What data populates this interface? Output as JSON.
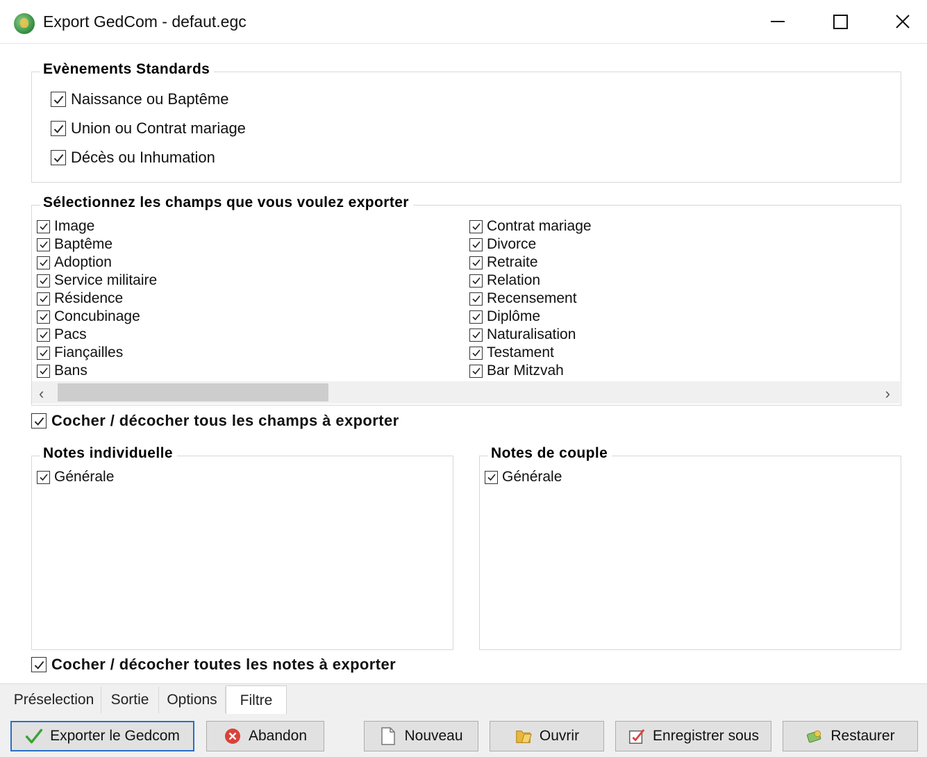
{
  "window": {
    "title": "Export GedCom - defaut.egc",
    "icon": "app-tree-icon",
    "controls": [
      "minimize-icon",
      "maximize-icon",
      "close-icon"
    ]
  },
  "standard_events": {
    "title": "Evènements Standards",
    "items": [
      {
        "label": "Naissance ou Baptême",
        "checked": true
      },
      {
        "label": "Union ou Contrat mariage",
        "checked": true
      },
      {
        "label": "Décès ou Inhumation",
        "checked": true
      }
    ]
  },
  "fields": {
    "title": "Sélectionnez les champs que vous voulez exporter",
    "col1": [
      {
        "label": "Image",
        "checked": true
      },
      {
        "label": "Baptême",
        "checked": true
      },
      {
        "label": "Adoption",
        "checked": true
      },
      {
        "label": "Service militaire",
        "checked": true
      },
      {
        "label": "Résidence",
        "checked": true
      },
      {
        "label": "Concubinage",
        "checked": true
      },
      {
        "label": "Pacs",
        "checked": true
      },
      {
        "label": "Fiançailles",
        "checked": true
      },
      {
        "label": "Bans",
        "checked": true
      }
    ],
    "col2": [
      {
        "label": "Contrat mariage",
        "checked": true
      },
      {
        "label": "Divorce",
        "checked": true
      },
      {
        "label": "Retraite",
        "checked": true
      },
      {
        "label": "Relation",
        "checked": true
      },
      {
        "label": "Recensement",
        "checked": true
      },
      {
        "label": "Diplôme",
        "checked": true
      },
      {
        "label": "Naturalisation",
        "checked": true
      },
      {
        "label": "Testament",
        "checked": true
      },
      {
        "label": "Bar Mitzvah",
        "checked": true
      }
    ]
  },
  "toggle_fields": {
    "label": "Cocher / décocher tous les champs à exporter",
    "checked": true
  },
  "notes_individual": {
    "title": "Notes individuelle",
    "items": [
      {
        "label": "Générale",
        "checked": true
      }
    ]
  },
  "notes_couple": {
    "title": "Notes de couple",
    "items": [
      {
        "label": "Générale",
        "checked": true
      }
    ]
  },
  "toggle_notes": {
    "label": "Cocher / décocher toutes les notes à exporter",
    "checked": true
  },
  "tabs": [
    {
      "label": "Préselection"
    },
    {
      "label": "Sortie"
    },
    {
      "label": "Options"
    },
    {
      "label": "Filtre",
      "active": true
    }
  ],
  "buttons": {
    "export": {
      "label": "Exporter le Gedcom",
      "icon": "checkmark-icon"
    },
    "abort": {
      "label": "Abandon",
      "icon": "cancel-icon"
    },
    "new": {
      "label": "Nouveau",
      "icon": "new-document-icon"
    },
    "open": {
      "label": "Ouvrir",
      "icon": "open-folder-icon"
    },
    "save_as": {
      "label": "Enregistrer sous",
      "icon": "save-as-icon"
    },
    "restore": {
      "label": "Restaurer",
      "icon": "restore-icon"
    }
  }
}
